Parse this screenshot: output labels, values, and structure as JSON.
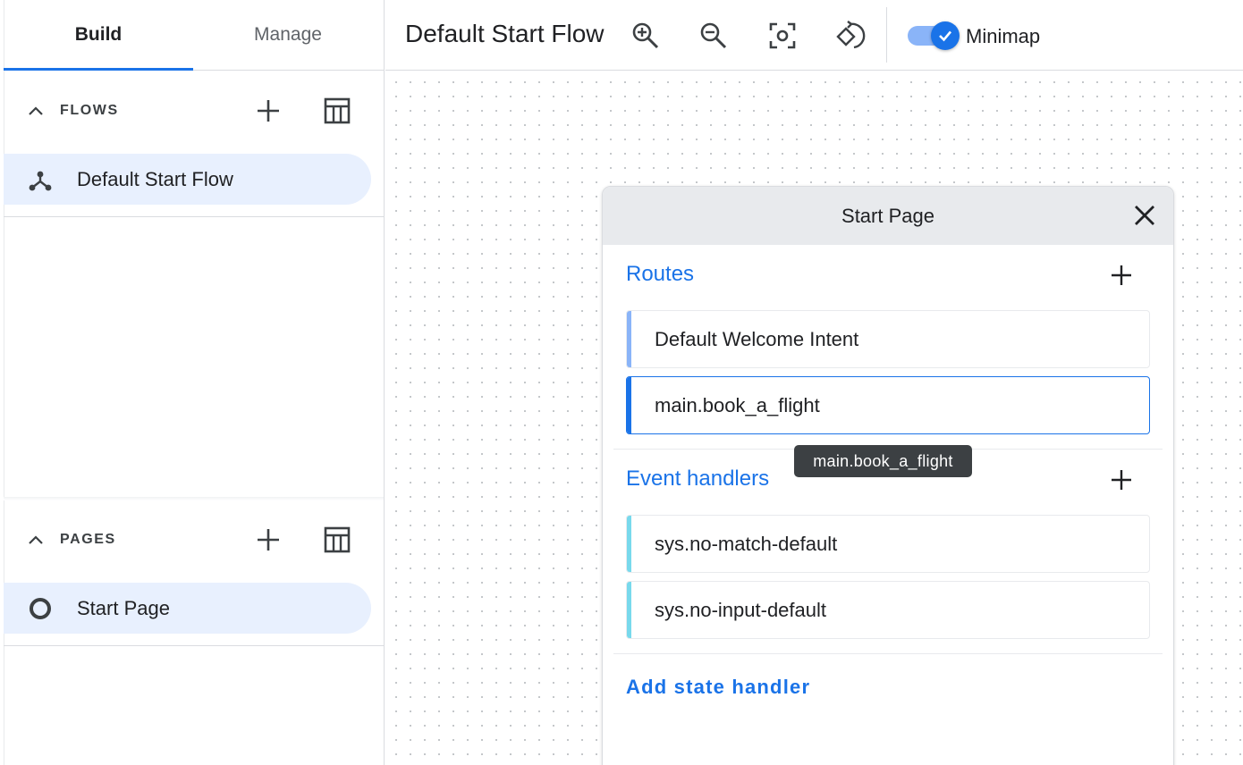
{
  "tabs": [
    {
      "label": "Build",
      "active": true
    },
    {
      "label": "Manage",
      "active": false
    }
  ],
  "flows": {
    "title": "FLOWS",
    "items": [
      {
        "label": "Default Start Flow",
        "icon": "flow-icon"
      }
    ]
  },
  "pages": {
    "title": "PAGES",
    "items": [
      {
        "label": "Start Page",
        "icon": "page-circle-icon"
      }
    ]
  },
  "toolbar": {
    "title": "Default Start Flow",
    "tools": [
      "zoom-in-icon",
      "zoom-out-icon",
      "focus-icon",
      "reset-rotate-icon"
    ],
    "minimap_label": "Minimap",
    "minimap_enabled": true
  },
  "card": {
    "title": "Start Page",
    "routes": {
      "label": "Routes",
      "items": [
        "Default Welcome Intent",
        "main.book_a_flight"
      ]
    },
    "event_handlers": {
      "label": "Event handlers",
      "items": [
        "sys.no-match-default",
        "sys.no-input-default"
      ]
    },
    "add_state_handler": "Add state handler"
  },
  "tooltip": "main.book_a_flight",
  "colors": {
    "accent": "#1a73e8",
    "route_bar": "#8ab4f8",
    "route_bar_selected": "#1a73e8",
    "event_bar": "#78d9ec",
    "selected_item_bg": "#e8f0fe"
  }
}
